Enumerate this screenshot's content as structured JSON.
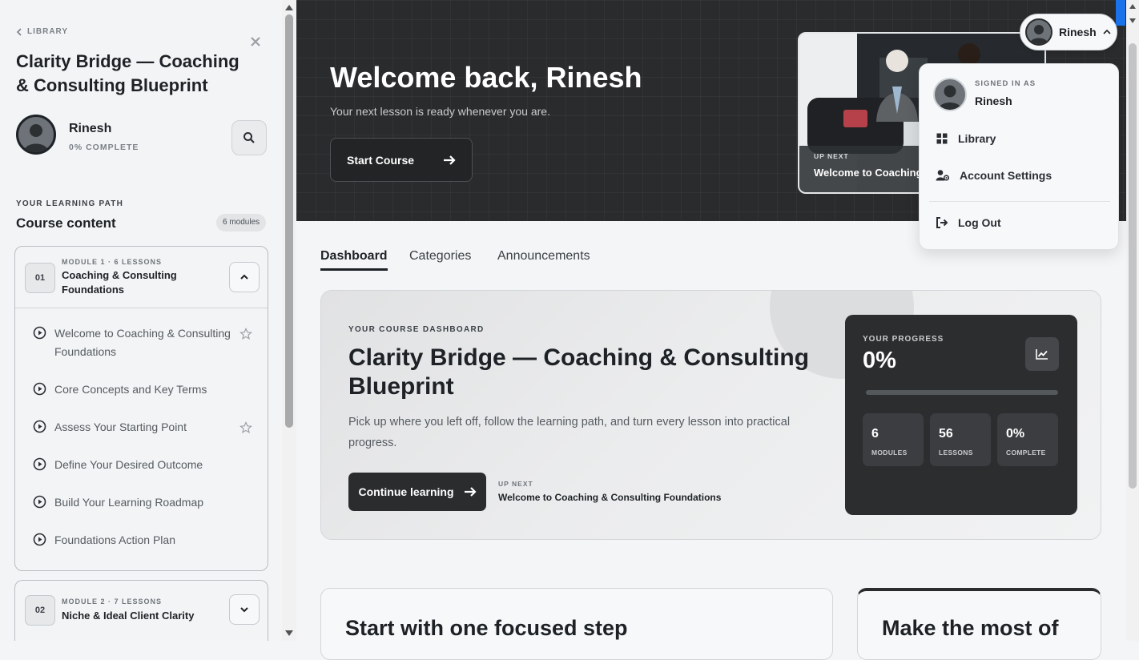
{
  "sidebar": {
    "back_label": "LIBRARY",
    "course_title": "Clarity Bridge — Coaching & Consulting Blueprint",
    "user_name": "Rinesh",
    "user_progress": "0% COMPLETE",
    "path_label": "YOUR LEARNING PATH",
    "content_title": "Course content",
    "modules_badge": "6 modules",
    "modules": [
      {
        "num": "01",
        "meta": "MODULE 1 · 6 LESSONS",
        "name": "Coaching & Consulting Foundations",
        "expanded": true,
        "lessons": [
          {
            "title": "Welcome to Coaching & Consulting Foundations",
            "star": true
          },
          {
            "title": "Core Concepts and Key Terms",
            "star": false
          },
          {
            "title": "Assess Your Starting Point",
            "star": true
          },
          {
            "title": "Define Your Desired Outcome",
            "star": false
          },
          {
            "title": "Build Your Learning Roadmap",
            "star": false
          },
          {
            "title": "Foundations Action Plan",
            "star": false
          }
        ]
      },
      {
        "num": "02",
        "meta": "MODULE 2 · 7 LESSONS",
        "name": "Niche & Ideal Client Clarity",
        "expanded": false
      }
    ]
  },
  "hero": {
    "title": "Welcome back, Rinesh",
    "subtitle": "Your next lesson is ready whenever you are.",
    "start_button": "Start Course",
    "thumb_upnext": "UP NEXT",
    "thumb_title": "Welcome to Coaching & Consulting Foundations"
  },
  "tabs": [
    {
      "label": "Dashboard",
      "active": true
    },
    {
      "label": "Categories",
      "active": false
    },
    {
      "label": "Announcements",
      "active": false
    }
  ],
  "dashboard": {
    "eyebrow": "YOUR COURSE DASHBOARD",
    "title": "Clarity Bridge — Coaching & Consulting Blueprint",
    "description": "Pick up where you left off, follow the learning path, and turn every lesson into practical progress.",
    "continue_button": "Continue learning",
    "upnext_label": "UP NEXT",
    "upnext_title": "Welcome to Coaching & Consulting Foundations",
    "progress": {
      "label": "YOUR PROGRESS",
      "percent": "0%",
      "fraction": 0,
      "stats": [
        {
          "value": "6",
          "label": "MODULES"
        },
        {
          "value": "56",
          "label": "LESSONS"
        },
        {
          "value": "0%",
          "label": "COMPLETE"
        }
      ]
    }
  },
  "bottom_cards": [
    {
      "title": "Start with one focused step"
    },
    {
      "title": "Make the most of"
    }
  ],
  "user_menu": {
    "pill_name": "Rinesh",
    "signed_in_label": "SIGNED IN AS",
    "name": "Rinesh",
    "items": [
      {
        "label": "Library",
        "icon": "grid-icon"
      },
      {
        "label": "Account Settings",
        "icon": "user-gear-icon"
      },
      {
        "label": "Log Out",
        "icon": "logout-icon"
      }
    ]
  },
  "colors": {
    "hero_bg": "#2a2b2d",
    "dark_card": "#2c2d2f",
    "accent_blue": "#1a73e8"
  }
}
